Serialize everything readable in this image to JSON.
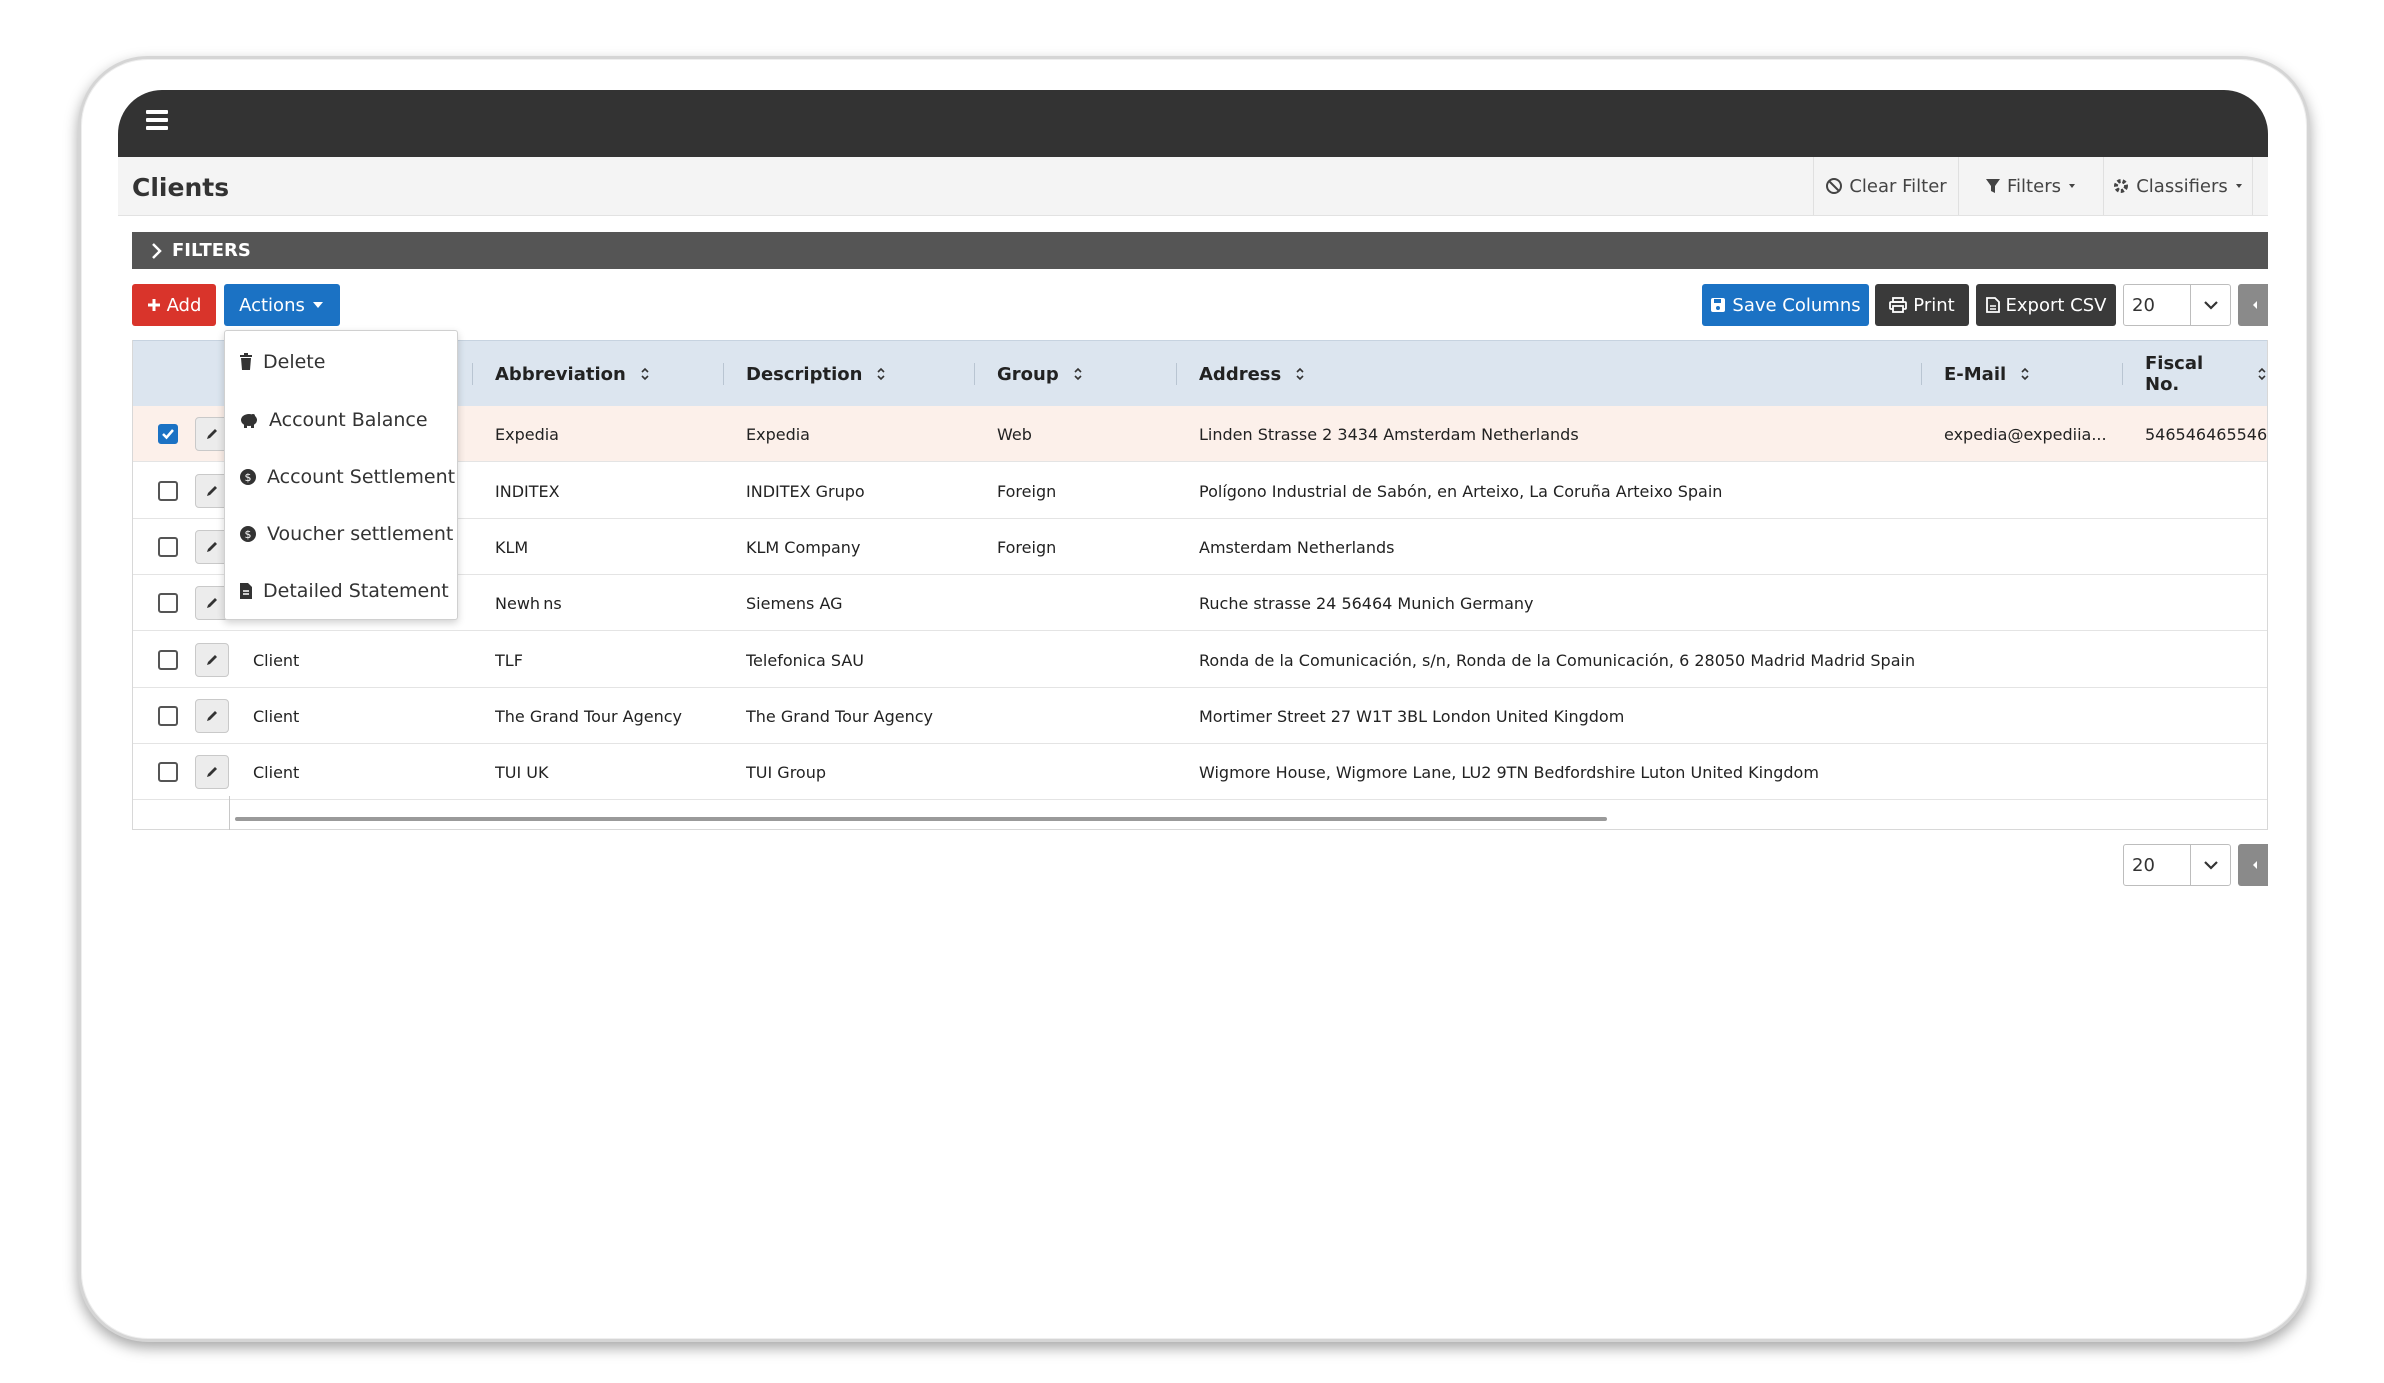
{
  "page": {
    "title": "Clients"
  },
  "header": {
    "clear_filter": "Clear Filter",
    "filters": "Filters",
    "classifiers": "Classifiers"
  },
  "filters_bar": {
    "label": "FILTERS"
  },
  "toolbar": {
    "add": "Add",
    "actions": "Actions",
    "save_columns": "Save Columns",
    "print": "Print",
    "export_csv": "Export CSV",
    "page_size": "20"
  },
  "actions_menu": {
    "items": [
      {
        "label": "Delete",
        "icon": "trash-icon"
      },
      {
        "label": "Account Balance",
        "icon": "piggy-bank-icon"
      },
      {
        "label": "Account Settlement",
        "icon": "coin-icon"
      },
      {
        "label": "Voucher settlement",
        "icon": "coin-icon"
      },
      {
        "label": "Detailed Statement",
        "icon": "document-icon"
      }
    ]
  },
  "table": {
    "columns": [
      "Abbreviation",
      "Description",
      "Group",
      "Address",
      "E-Mail",
      "Fiscal No."
    ],
    "rows": [
      {
        "checked": true,
        "type": "",
        "abbreviation": "Expedia",
        "description": "Expedia",
        "group": "Web",
        "address": "Linden Strasse 2 3434 Amsterdam Netherlands",
        "email": "expedia@expediia...",
        "fiscal": "546546465546"
      },
      {
        "checked": false,
        "type": "",
        "abbreviation": "INDITEX",
        "description": "INDITEX Grupo",
        "group": "Foreign",
        "address": "Polígono Industrial de Sabón, en Arteixo, La Coruña Arteixo Spain",
        "email": "",
        "fiscal": ""
      },
      {
        "checked": false,
        "type": "",
        "abbreviation": "KLM",
        "description": "KLM Company",
        "group": "Foreign",
        "address": "Amsterdam Netherlands",
        "email": "",
        "fiscal": ""
      },
      {
        "checked": false,
        "type": "",
        "abbreviation": "Newh ns",
        "description": "Siemens AG",
        "group": "",
        "address": "Ruche strasse 24 56464 Munich Germany",
        "email": "",
        "fiscal": ""
      },
      {
        "checked": false,
        "type": "Client",
        "abbreviation": "TLF",
        "description": "Telefonica SAU",
        "group": "",
        "address": "Ronda de la Comunicación, s/n, Ronda de la Comunicación, 6 28050 Madrid Madrid Spain",
        "email": "",
        "fiscal": ""
      },
      {
        "checked": false,
        "type": "Client",
        "abbreviation": "The Grand Tour Agency",
        "description": "The Grand Tour Agency",
        "group": "",
        "address": "Mortimer Street 27 W1T 3BL London United Kingdom",
        "email": "",
        "fiscal": ""
      },
      {
        "checked": false,
        "type": "Client",
        "abbreviation": "TUI UK",
        "description": "TUI Group",
        "group": "",
        "address": "Wigmore House, Wigmore Lane, LU2 9TN Bedfordshire Luton United Kingdom",
        "email": "",
        "fiscal": ""
      }
    ]
  },
  "footer": {
    "page_size": "20"
  }
}
